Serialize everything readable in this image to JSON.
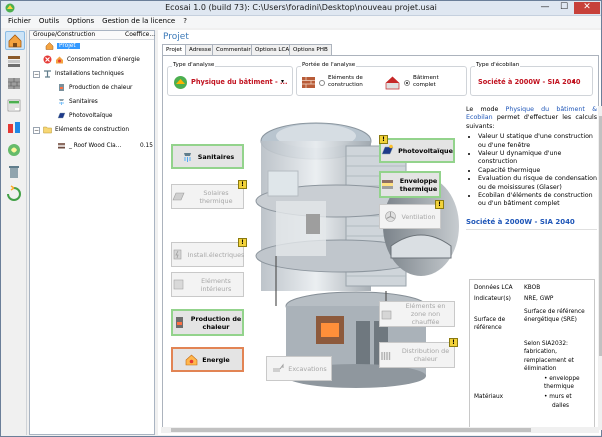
{
  "window": {
    "title": "Ecosai 1.0 (build 73): C:\\Users\\foradini\\Desktop\\nouveau projet.usai",
    "min": "—",
    "max": "☐",
    "close": "✕"
  },
  "menu": [
    "Fichier",
    "Outils",
    "Options",
    "Gestion de la licence",
    "?"
  ],
  "tree": {
    "col1": "Groupe/Construction",
    "col2": "Coeffice...",
    "nodes": [
      {
        "label": "Projet",
        "value": ""
      },
      {
        "label": "Consommation d'énergie",
        "value": ""
      },
      {
        "label": "Installations techniques",
        "value": ""
      },
      {
        "label": "Production de chaleur",
        "value": ""
      },
      {
        "label": "Sanitaires",
        "value": ""
      },
      {
        "label": "Photovoltaïque",
        "value": ""
      },
      {
        "label": "Eléments de construction",
        "value": ""
      },
      {
        "label": "_ Roof Wood Cla...",
        "value": "0.15"
      }
    ]
  },
  "main": {
    "heading": "Projet",
    "tabs": [
      "Projet",
      "Adresse",
      "Commentaire",
      "Options LCA",
      "Options PHB"
    ]
  },
  "analysis": {
    "type_label": "Type d'analyse",
    "type_value": "Physique du bâtiment - ...",
    "scope_label": "Portée de l'analyse",
    "scope_opt1": "Eléments de construction",
    "scope_opt2": "Bâtiment complet",
    "ecobilan_label": "Type d'écobilan",
    "ecobilan_value": "Société à 2000W - SIA 2040"
  },
  "systems": {
    "sanitaires": "Sanitaires",
    "solaires": "Solaires thermique",
    "install_elec": "Install.électriques",
    "elements_int": "Eléments intérieurs",
    "production": "Production de chaleur",
    "energie": "Energie",
    "excavations": "Excavations",
    "photovoltaique": "Photovoltaïque",
    "enveloppe": "Enveloppe thermique",
    "ventilation": "Ventilation",
    "elements_zone": "Eléments en zone non chauffée",
    "distribution": "Distribution de chaleur"
  },
  "info": {
    "intro_prefix": "Le mode",
    "intro_mode": "Physique du bâtiment & Ecobilan",
    "intro_suffix": "permet d'effectuer les calculs suivants:",
    "bullets": [
      "Valeur U statique d'une construction ou d'une fenêtre",
      "Valeur U dynamique d'une construction",
      "Capacité thermique",
      "Evaluation du risque de condensation ou de moisissures (Glaser)",
      "Ecobilan d'éléments de construction ou d'un bâtiment complet"
    ],
    "subheading": "Société à 2000W - SIA 2040",
    "table": [
      {
        "k": "Données LCA",
        "v": "KBOB"
      },
      {
        "k": "Indicateur(s)",
        "v": "NRE, GWP"
      },
      {
        "k": "Surface de référence",
        "v": "Surface de référence énergétique (SRE)"
      },
      {
        "k": "",
        "v": "Selon SIA2032: fabrication, remplacement et élimination"
      },
      {
        "k": "",
        "v": "• enveloppe thermique"
      },
      {
        "k": "Matériaux",
        "v": "• murs et"
      },
      {
        "k": "",
        "v": "dalles"
      }
    ]
  },
  "colors": {
    "accent": "#3d7ab8",
    "active_border": "#93d38c",
    "energy_border": "#e28454",
    "selection": "#3399ff",
    "red_text": "#c1121f"
  }
}
